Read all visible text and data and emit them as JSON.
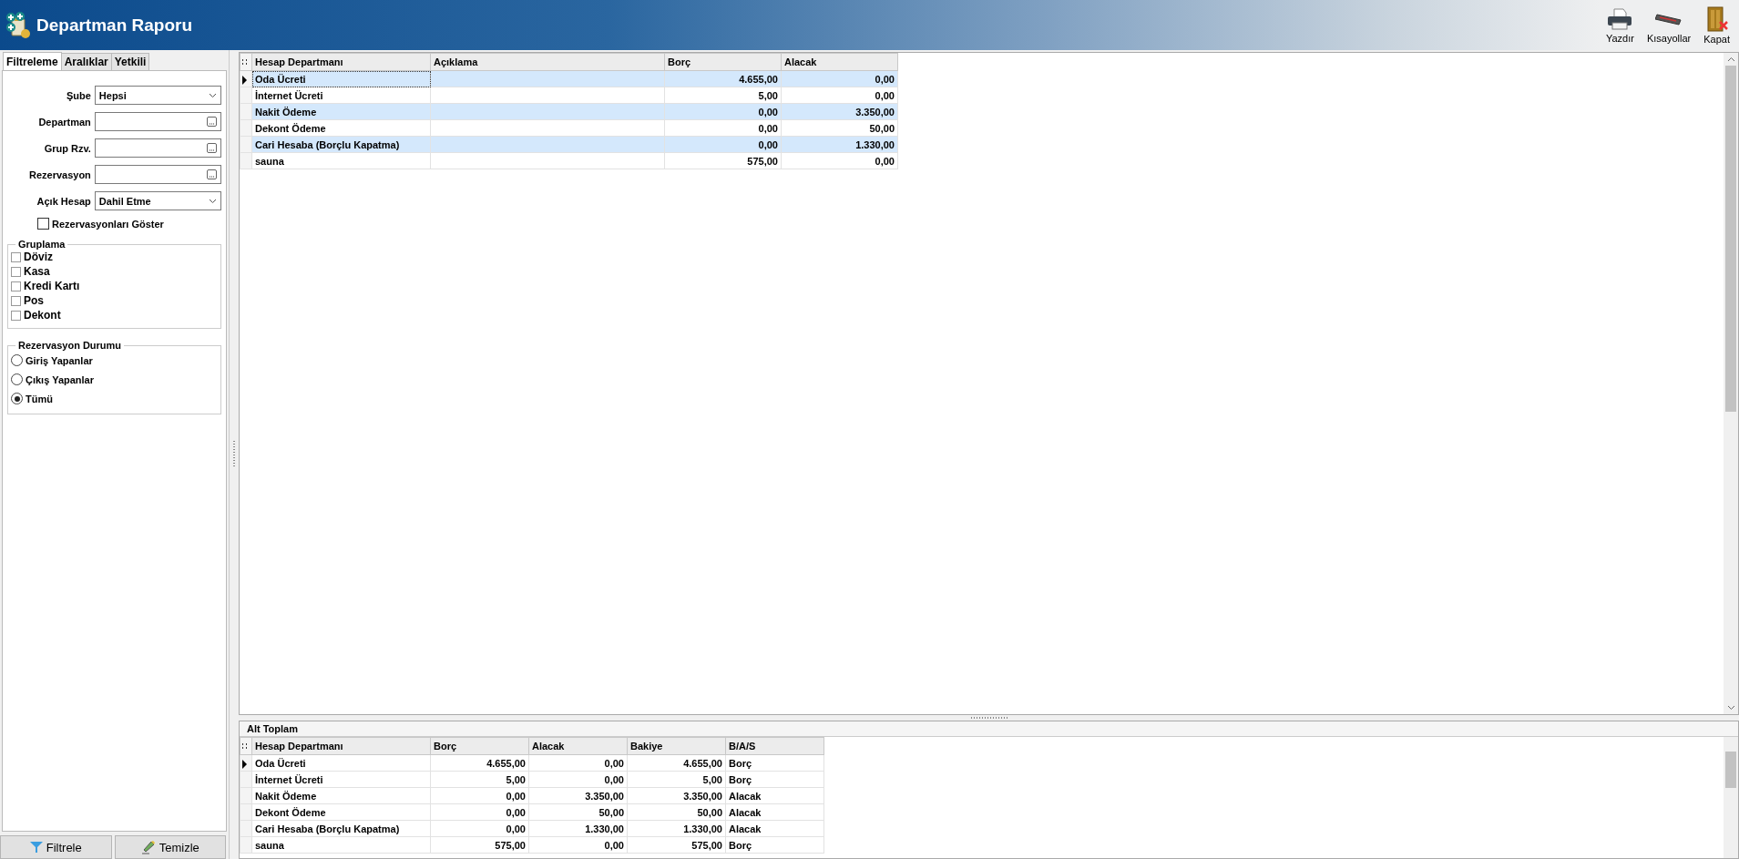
{
  "window": {
    "title": "Departman Raporu"
  },
  "toolbar": [
    {
      "label": "Yazdır",
      "kind": "print"
    },
    {
      "label": "Kısayollar",
      "kind": "keyboard"
    },
    {
      "label": "Kapat",
      "kind": "close"
    }
  ],
  "tabs": [
    {
      "label": "Filtreleme",
      "selected": true
    },
    {
      "label": "Aralıklar",
      "selected": false
    },
    {
      "label": "Yetkili",
      "selected": false
    }
  ],
  "filters": [
    {
      "label": "Şube",
      "kind": "dropdown",
      "value": "Hepsi"
    },
    {
      "label": "Departman",
      "kind": "lookup"
    },
    {
      "label": "Grup Rzv.",
      "kind": "lookup"
    },
    {
      "label": "Rezervasyon",
      "kind": "lookup"
    },
    {
      "label": "Açık Hesap",
      "kind": "dropdown",
      "value": "Dahil Etme"
    }
  ],
  "show_reservations": {
    "label": "Rezervasyonları Göster",
    "checked": false
  },
  "grouping": {
    "title": "Gruplama",
    "options": [
      {
        "label": "Döviz",
        "checked": false
      },
      {
        "label": "Kasa",
        "checked": false
      },
      {
        "label": "Kredi Kartı",
        "checked": false
      },
      {
        "label": "Pos",
        "checked": false
      },
      {
        "label": "Dekont",
        "checked": false
      }
    ]
  },
  "reservation_status": {
    "title": "Rezervasyon Durumu",
    "options": [
      {
        "label": "Giriş Yapanlar",
        "selected": false
      },
      {
        "label": "Çıkış Yapanlar",
        "selected": false
      },
      {
        "label": "Tümü",
        "selected": true
      }
    ]
  },
  "buttons": [
    {
      "label": "Filtrele",
      "kind": "filter"
    },
    {
      "label": "Temizle",
      "kind": "clear"
    }
  ],
  "main_table": {
    "columns": [
      "Hesap Departmanı",
      "Açıklama",
      "Borç",
      "Alacak"
    ],
    "rows": [
      {
        "selected": true,
        "department": "Oda Ücreti",
        "debit": "4.655,00",
        "credit": "0,00"
      },
      {
        "selected": false,
        "department": "İnternet Ücreti",
        "debit": "5,00",
        "credit": "0,00"
      },
      {
        "selected": false,
        "department": "Nakit Ödeme",
        "debit": "0,00",
        "credit": "3.350,00"
      },
      {
        "selected": false,
        "department": "Dekont Ödeme",
        "debit": "0,00",
        "credit": "50,00"
      },
      {
        "selected": false,
        "department": "Cari Hesaba (Borçlu Kapatma)",
        "debit": "0,00",
        "credit": "1.330,00"
      },
      {
        "selected": false,
        "department": "sauna",
        "debit": "575,00",
        "credit": "0,00"
      }
    ]
  },
  "subtotal": {
    "title": "Alt Toplam",
    "columns": [
      "Hesap Departmanı",
      "Borç",
      "Alacak",
      "Bakiye",
      "B/A/S"
    ],
    "rows": [
      {
        "selected": true,
        "department": "Oda Ücreti",
        "debit": "4.655,00",
        "credit": "0,00",
        "balance": "4.655,00",
        "side": "Borç"
      },
      {
        "selected": false,
        "department": "İnternet Ücreti",
        "debit": "5,00",
        "credit": "0,00",
        "balance": "5,00",
        "side": "Borç"
      },
      {
        "selected": false,
        "department": "Nakit Ödeme",
        "debit": "0,00",
        "credit": "3.350,00",
        "balance": "3.350,00",
        "side": "Alacak"
      },
      {
        "selected": false,
        "department": "Dekont Ödeme",
        "debit": "0,00",
        "credit": "50,00",
        "balance": "50,00",
        "side": "Alacak"
      },
      {
        "selected": false,
        "department": "Cari Hesaba (Borçlu Kapatma)",
        "debit": "0,00",
        "credit": "1.330,00",
        "balance": "1.330,00",
        "side": "Alacak"
      },
      {
        "selected": false,
        "department": "sauna",
        "debit": "575,00",
        "credit": "0,00",
        "balance": "575,00",
        "side": "Borç"
      }
    ]
  }
}
